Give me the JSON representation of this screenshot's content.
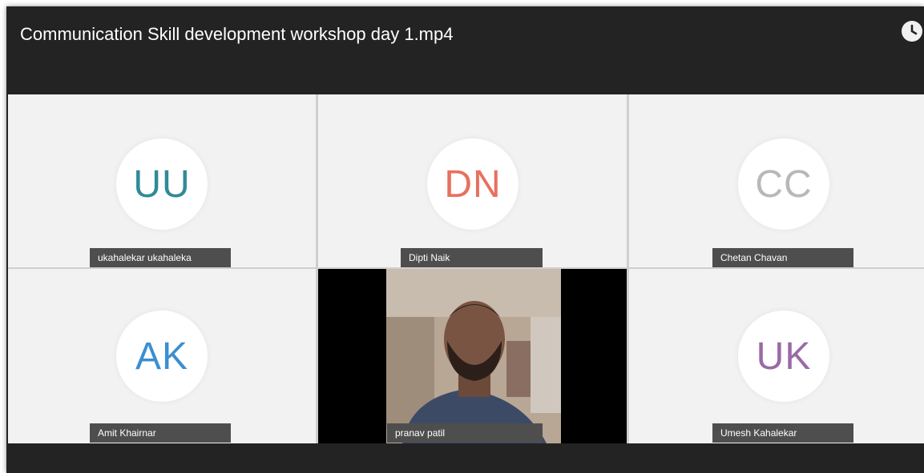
{
  "window": {
    "title": "Communication Skill development workshop day 1.mp4",
    "clock_icon": "clock-icon"
  },
  "participants": [
    {
      "initials": "UU",
      "name": "ukahalekar ukahaleka",
      "color": "#2e8b96"
    },
    {
      "initials": "DN",
      "name": "Dipti Naik",
      "color": "#e8705e"
    },
    {
      "initials": "CC",
      "name": "Chetan Chavan",
      "color": "#b8b8b8"
    },
    {
      "initials": "AK",
      "name": "Amit Khairnar",
      "color": "#3a8fd0"
    },
    {
      "initials": "",
      "name": "pranav patil",
      "video": true
    },
    {
      "initials": "UK",
      "name": "Umesh Kahalekar",
      "color": "#9a6aa6"
    }
  ]
}
